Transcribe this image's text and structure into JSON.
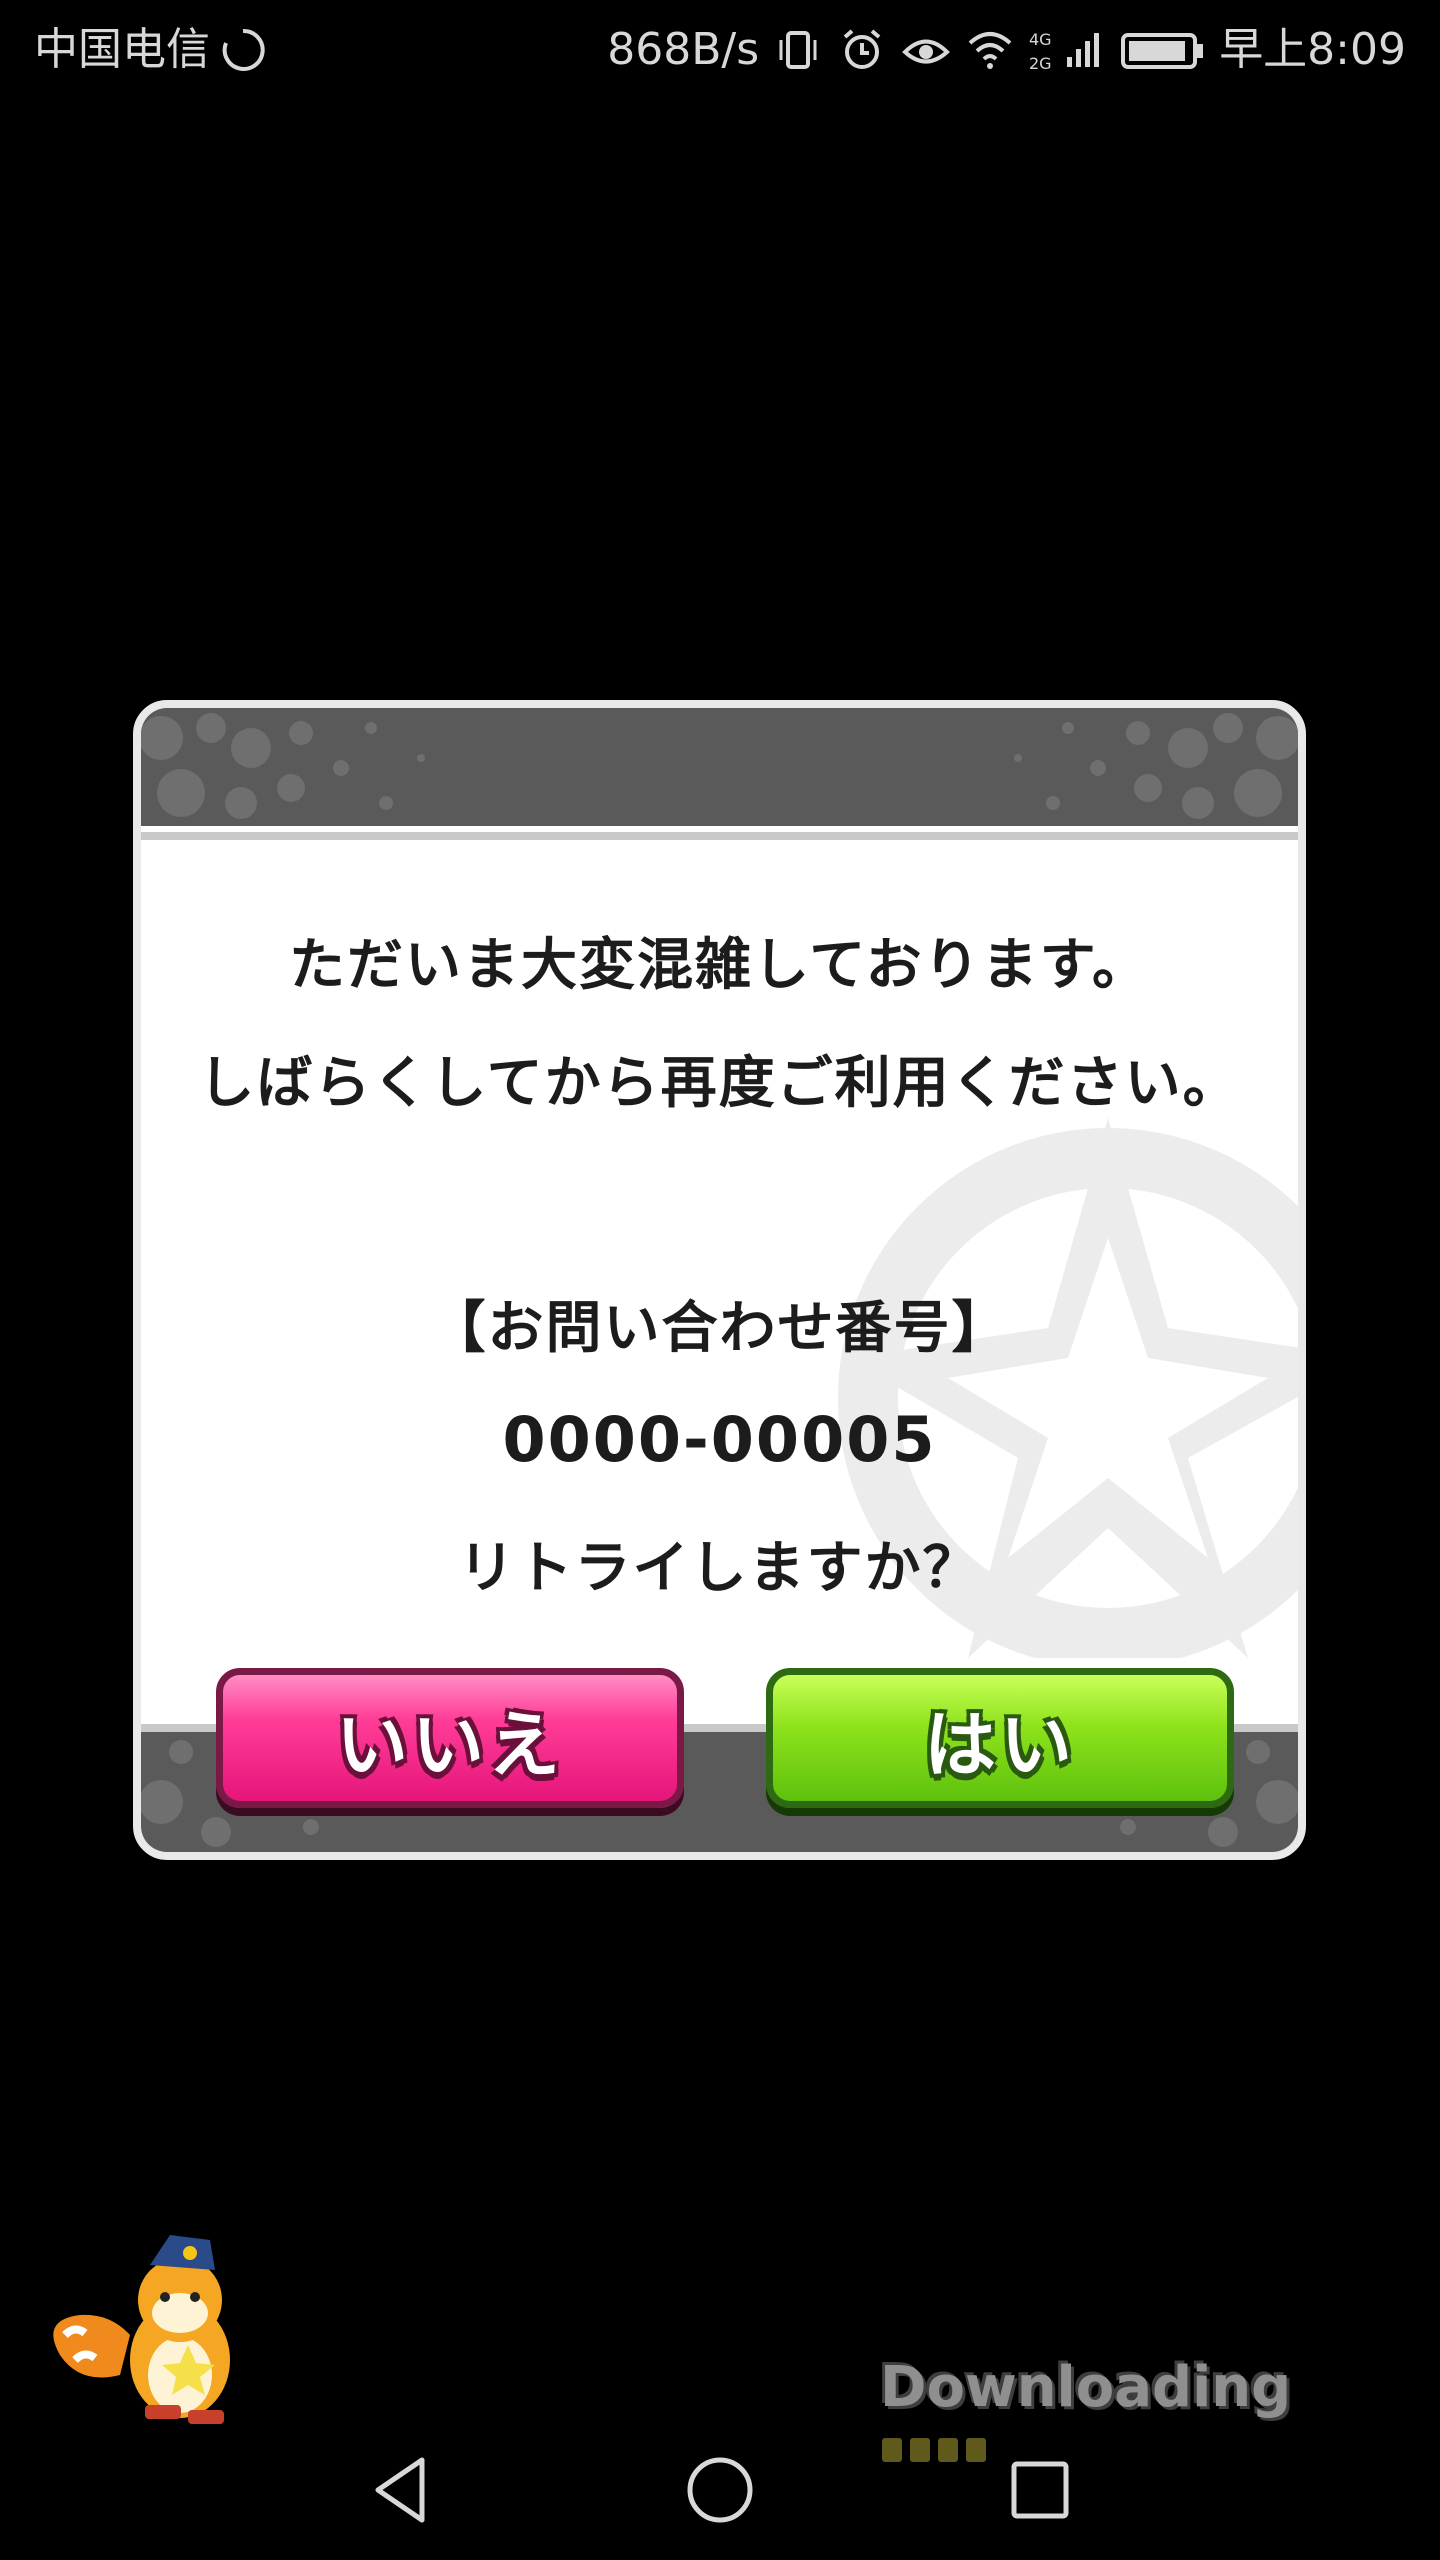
{
  "status_bar": {
    "carrier": "中国电信",
    "net_speed": "868B/s",
    "network_type": "4G 2G",
    "time": "早上8:09",
    "icons": [
      "loading-spinner-icon",
      "vibrate-icon",
      "alarm-icon",
      "eye-icon",
      "wifi-icon",
      "signal-icon",
      "battery-icon"
    ]
  },
  "dialog": {
    "message_line1": "ただいま大変混雑しております。",
    "message_line2": "しばらくしてから再度ご利用ください。",
    "inquiry_label": "【お問い合わせ番号】",
    "inquiry_number": "0000-00005",
    "question": "リトライしますか？",
    "no_label": "いいえ",
    "yes_label": "はい",
    "colors": {
      "no_button": "#ff3d98",
      "yes_button": "#8fe31c",
      "band": "#5a5a5a"
    }
  },
  "loading": {
    "label": "Downloading",
    "progress_segments": 4
  },
  "nav_bar": {
    "icons": [
      "back-icon",
      "home-icon",
      "recent-apps-icon"
    ]
  }
}
